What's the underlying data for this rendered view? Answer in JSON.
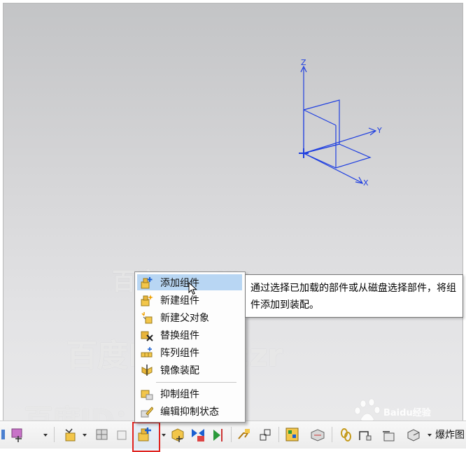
{
  "colors": {
    "axis": "#1f3fe0",
    "menu_highlight": "#b8d6f3",
    "active_outline": "#e0231f"
  },
  "viewport": {
    "axis_labels": {
      "z": "Z",
      "y": "Y",
      "x": "X"
    }
  },
  "watermarks": [
    "百度ID：ffjczr",
    "百度ID：ffjczr",
    "百度ID："
  ],
  "baidu_badge": {
    "brand": "Baidu",
    "suffix": "经验"
  },
  "context_menu": {
    "items": [
      {
        "label": "添加组件",
        "icon": "add-component-icon",
        "highlighted": true
      },
      {
        "label": "新建组件",
        "icon": "new-component-icon"
      },
      {
        "label": "新建父对象",
        "icon": "new-parent-icon"
      },
      {
        "label": "替换组件",
        "icon": "replace-component-icon"
      },
      {
        "label": "阵列组件",
        "icon": "array-component-icon"
      },
      {
        "label": "镜像装配",
        "icon": "mirror-assembly-icon"
      },
      {
        "label": "抑制组件",
        "icon": "suppress-component-icon"
      },
      {
        "label": "编辑抑制状态",
        "icon": "edit-suppression-icon"
      }
    ]
  },
  "tooltip": {
    "text": "通过选择已加载的部件或从磁盘选择部件，将组件添加到装配。"
  },
  "toolbar": {
    "explode_label": "爆炸图"
  }
}
